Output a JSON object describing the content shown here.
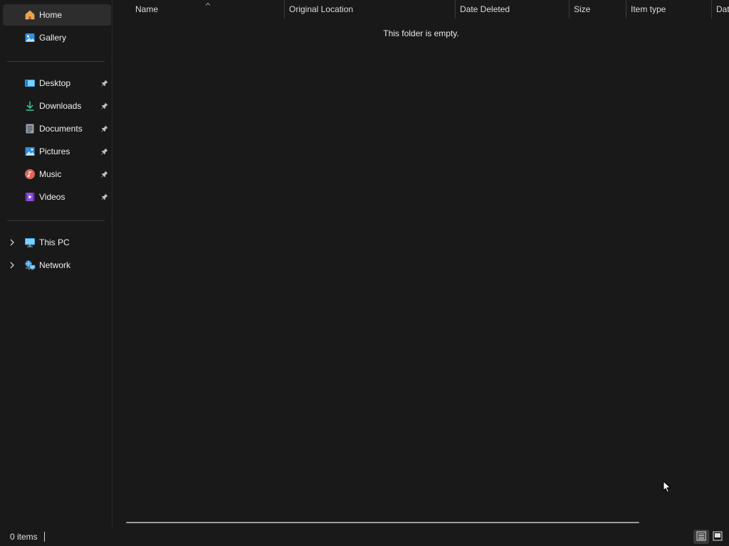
{
  "sidebar": {
    "quick": [
      {
        "label": "Home",
        "icon": "home-icon",
        "selected": true
      },
      {
        "label": "Gallery",
        "icon": "gallery-icon",
        "selected": false
      }
    ],
    "pinned": [
      {
        "label": "Desktop",
        "icon": "desktop-icon"
      },
      {
        "label": "Downloads",
        "icon": "downloads-icon"
      },
      {
        "label": "Documents",
        "icon": "documents-icon"
      },
      {
        "label": "Pictures",
        "icon": "pictures-icon"
      },
      {
        "label": "Music",
        "icon": "music-icon"
      },
      {
        "label": "Videos",
        "icon": "videos-icon"
      }
    ],
    "locations": [
      {
        "label": "This PC",
        "icon": "this-pc-icon"
      },
      {
        "label": "Network",
        "icon": "network-icon"
      }
    ]
  },
  "columns": [
    "Name",
    "Original Location",
    "Date Deleted",
    "Size",
    "Item type",
    "Dat"
  ],
  "main": {
    "empty_message": "This folder is empty."
  },
  "status": {
    "item_count": "0 items",
    "view_mode": "details"
  },
  "colors": {
    "background": "#191919",
    "selected": "#2d2d2d",
    "text": "#e6e6e6"
  }
}
